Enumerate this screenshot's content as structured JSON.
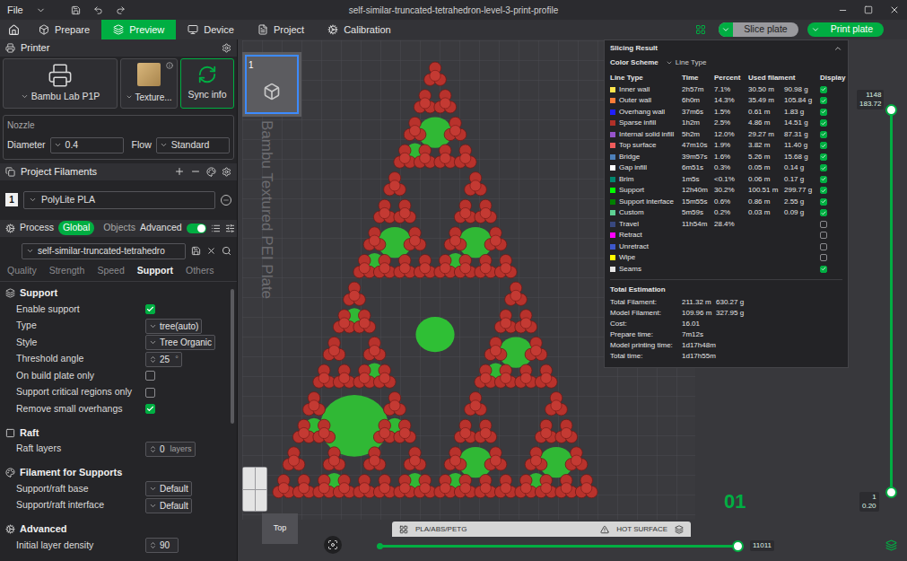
{
  "window": {
    "title": "self-similar-truncated-tetrahedron-level-3-print-profile",
    "menu": "File"
  },
  "tabs": [
    {
      "label": "Prepare",
      "selected": false
    },
    {
      "label": "Preview",
      "selected": true
    },
    {
      "label": "Device",
      "selected": false
    },
    {
      "label": "Project",
      "selected": false
    },
    {
      "label": "Calibration",
      "selected": false
    }
  ],
  "actions": {
    "slice": "Slice plate",
    "print": "Print plate"
  },
  "sidebar": {
    "printer": {
      "title": "Printer",
      "name": "Bambu Lab P1P",
      "plate": "Texture...",
      "sync": "Sync info"
    },
    "nozzle": {
      "title": "Nozzle",
      "diameter_label": "Diameter",
      "diameter": "0.4",
      "flow_label": "Flow",
      "flow": "Standard"
    },
    "filaments": {
      "title": "Project Filaments",
      "items": [
        {
          "index": "1",
          "name": "PolyLite PLA"
        }
      ]
    },
    "process": {
      "title": "Process",
      "scopes": [
        {
          "label": "Global",
          "selected": true
        },
        {
          "label": "Objects",
          "selected": false
        }
      ],
      "advanced": {
        "label": "Advanced",
        "on": true
      },
      "preset": "self-similar-truncated-tetrahedro"
    },
    "tabs": [
      {
        "label": "Quality",
        "selected": false
      },
      {
        "label": "Strength",
        "selected": false
      },
      {
        "label": "Speed",
        "selected": false
      },
      {
        "label": "Support",
        "selected": true
      },
      {
        "label": "Others",
        "selected": false
      }
    ],
    "sections": [
      {
        "title": "Support",
        "rows": [
          {
            "kind": "checkbox",
            "label": "Enable support",
            "checked": true,
            "value": "",
            "unit": ""
          },
          {
            "kind": "select",
            "label": "Type",
            "checked": false,
            "value": "tree(auto)",
            "unit": ""
          },
          {
            "kind": "select",
            "label": "Style",
            "checked": false,
            "value": "Tree Organic",
            "unit": ""
          },
          {
            "kind": "number",
            "label": "Threshold angle",
            "checked": false,
            "value": "25",
            "unit": "°"
          },
          {
            "kind": "checkbox",
            "label": "On build plate only",
            "checked": false,
            "value": "",
            "unit": ""
          },
          {
            "kind": "checkbox",
            "label": "Support critical regions only",
            "checked": false,
            "value": "",
            "unit": ""
          },
          {
            "kind": "checkbox",
            "label": "Remove small overhangs",
            "checked": true,
            "value": "",
            "unit": ""
          }
        ]
      },
      {
        "title": "Raft",
        "rows": [
          {
            "kind": "number",
            "label": "Raft layers",
            "checked": false,
            "value": "0",
            "unit": "layers"
          }
        ]
      },
      {
        "title": "Filament for Supports",
        "rows": [
          {
            "kind": "select",
            "label": "Support/raft base",
            "checked": false,
            "value": "Default",
            "unit": ""
          },
          {
            "kind": "select",
            "label": "Support/raft interface",
            "checked": false,
            "value": "Default",
            "unit": ""
          }
        ]
      },
      {
        "title": "Advanced",
        "rows": [
          {
            "kind": "number",
            "label": "Initial layer density",
            "checked": false,
            "value": "90",
            "unit": ""
          }
        ]
      }
    ]
  },
  "viewport": {
    "plate_index": "1",
    "plate_name": "Bambu Textured PEI Plate",
    "plate_number": "01",
    "plate_tags": [
      "PLA/ABS/PETG",
      "HOT SURFACE"
    ],
    "view": "Top",
    "layer_slider": {
      "top": "1148",
      "top_height": "183.72",
      "bottom": "1",
      "bottom_height": "0.20",
      "level": 1
    },
    "move_slider": {
      "value": "11011",
      "level": 1
    }
  },
  "slicing_result": {
    "title": "Slicing Result",
    "scheme_label": "Color Scheme",
    "scheme": "Line Type",
    "columns": [
      "Line Type",
      "Time",
      "Percent",
      "Used filament",
      "Display"
    ],
    "rows": [
      {
        "name": "Inner wall",
        "time": "2h57m",
        "percent": "7.1%",
        "meters": "30.50 m",
        "grams": "90.98 g",
        "display": true,
        "color": "#ffe64d"
      },
      {
        "name": "Outer wall",
        "time": "6h0m",
        "percent": "14.3%",
        "meters": "35.49 m",
        "grams": "105.84 g",
        "display": true,
        "color": "#ff7d38"
      },
      {
        "name": "Overhang wall",
        "time": "37m6s",
        "percent": "1.5%",
        "meters": "0.61 m",
        "grams": "1.83 g",
        "display": true,
        "color": "#1f1fff"
      },
      {
        "name": "Sparse infill",
        "time": "1h2m",
        "percent": "2.5%",
        "meters": "4.86 m",
        "grams": "14.51 g",
        "display": true,
        "color": "#b03029"
      },
      {
        "name": "Internal solid infill",
        "time": "5h2m",
        "percent": "12.0%",
        "meters": "29.27 m",
        "grams": "87.31 g",
        "display": true,
        "color": "#9654cc"
      },
      {
        "name": "Top surface",
        "time": "47m10s",
        "percent": "1.9%",
        "meters": "3.82 m",
        "grams": "11.40 g",
        "display": true,
        "color": "#f05c5c"
      },
      {
        "name": "Bridge",
        "time": "39m57s",
        "percent": "1.6%",
        "meters": "5.26 m",
        "grams": "15.68 g",
        "display": true,
        "color": "#4d80ba"
      },
      {
        "name": "Gap infill",
        "time": "6m51s",
        "percent": "0.3%",
        "meters": "0.05 m",
        "grams": "0.14 g",
        "display": true,
        "color": "#ffffff"
      },
      {
        "name": "Brim",
        "time": "1m5s",
        "percent": "<0.1%",
        "meters": "0.06 m",
        "grams": "0.17 g",
        "display": true,
        "color": "#00876e"
      },
      {
        "name": "Support",
        "time": "12h40m",
        "percent": "30.2%",
        "meters": "100.51 m",
        "grams": "299.77 g",
        "display": true,
        "color": "#00ff00"
      },
      {
        "name": "Support interface",
        "time": "15m55s",
        "percent": "0.6%",
        "meters": "0.86 m",
        "grams": "2.55 g",
        "display": true,
        "color": "#008000"
      },
      {
        "name": "Custom",
        "time": "5m59s",
        "percent": "0.2%",
        "meters": "0.03 m",
        "grams": "0.09 g",
        "display": true,
        "color": "#5ed194"
      },
      {
        "name": "Travel",
        "time": "11h54m",
        "percent": "28.4%",
        "meters": "",
        "grams": "",
        "display": false,
        "color": "#38487f"
      },
      {
        "name": "Retract",
        "time": "",
        "percent": "",
        "meters": "",
        "grams": "",
        "display": false,
        "color": "#ff00ff"
      },
      {
        "name": "Unretract",
        "time": "",
        "percent": "",
        "meters": "",
        "grams": "",
        "display": false,
        "color": "#3d58cc"
      },
      {
        "name": "Wipe",
        "time": "",
        "percent": "",
        "meters": "",
        "grams": "",
        "display": false,
        "color": "#ffff00"
      },
      {
        "name": "Seams",
        "time": "",
        "percent": "",
        "meters": "",
        "grams": "",
        "display": true,
        "color": "#e6e6e6"
      }
    ],
    "totals_title": "Total Estimation",
    "totals": [
      {
        "label": "Total Filament:",
        "values": [
          "211.32 m",
          "630.27 g"
        ]
      },
      {
        "label": "Model Filament:",
        "values": [
          "109.96 m",
          "327.95 g"
        ]
      },
      {
        "label": "Cost:",
        "values": [
          "16.01"
        ]
      },
      {
        "label": "Prepare time:",
        "values": [
          "7m12s"
        ]
      },
      {
        "label": "Model printing time:",
        "values": [
          "1d17h48m"
        ]
      },
      {
        "label": "Total time:",
        "values": [
          "1d17h55m"
        ]
      }
    ]
  }
}
